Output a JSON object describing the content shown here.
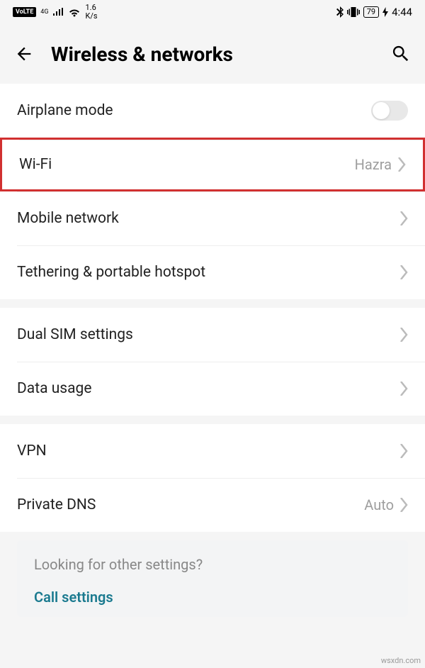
{
  "status": {
    "volte": "VoLTE",
    "net_type": "4G",
    "speed": "1.6\nK/s",
    "battery": "79",
    "time": "4:44"
  },
  "header": {
    "title": "Wireless & networks"
  },
  "sections": [
    {
      "rows": [
        {
          "label": "Airplane mode",
          "type": "toggle",
          "on": false
        },
        {
          "label": "Wi-Fi",
          "value": "Hazra",
          "type": "link",
          "highlight": true
        },
        {
          "label": "Mobile network",
          "type": "link"
        },
        {
          "label": "Tethering & portable hotspot",
          "type": "link"
        }
      ]
    },
    {
      "rows": [
        {
          "label": "Dual SIM settings",
          "type": "link"
        },
        {
          "label": "Data usage",
          "type": "link"
        }
      ]
    },
    {
      "rows": [
        {
          "label": "VPN",
          "type": "link"
        },
        {
          "label": "Private DNS",
          "value": "Auto",
          "type": "link"
        }
      ]
    }
  ],
  "footer": {
    "prompt": "Looking for other settings?",
    "link": "Call settings"
  },
  "watermark": "wsxdn.com"
}
